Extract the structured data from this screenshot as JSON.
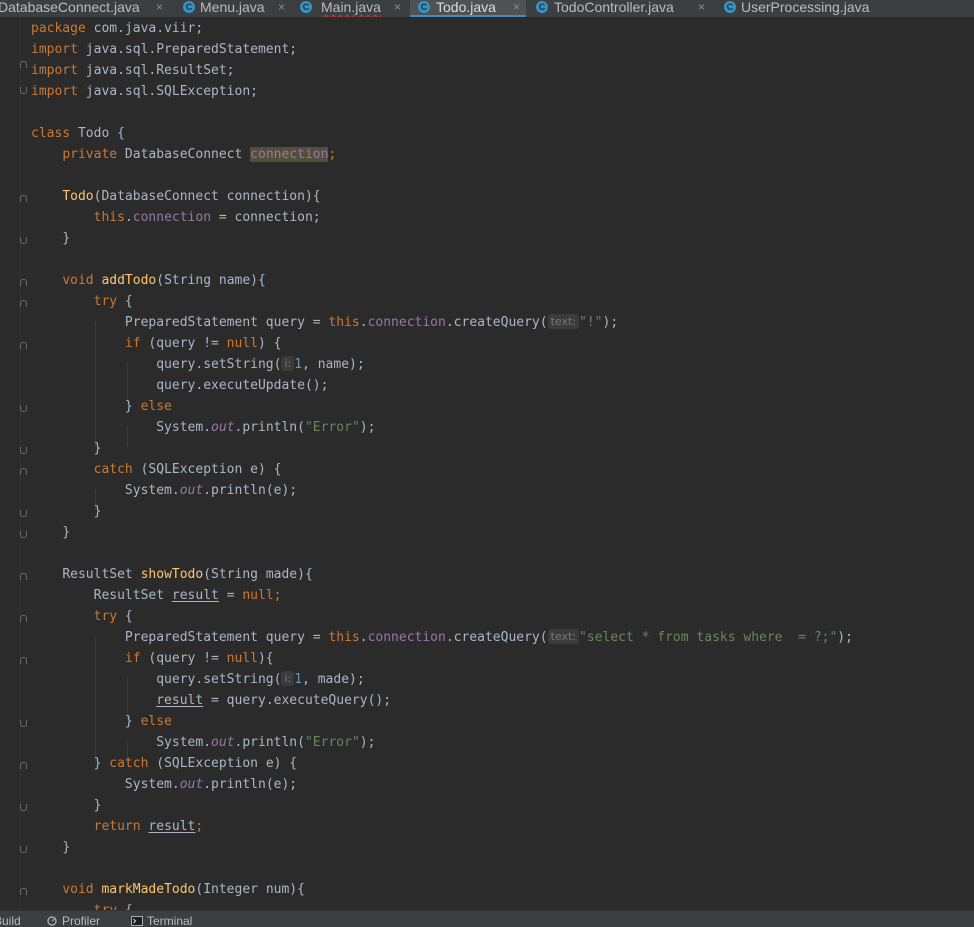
{
  "tabs": [
    {
      "label": "DatabaseConnect.java",
      "close": "×",
      "active": false,
      "icon": "C"
    },
    {
      "label": "Menu.java",
      "close": "×",
      "active": false,
      "icon": "C"
    },
    {
      "label": "Main.java",
      "close": "×",
      "active": false,
      "icon": "C"
    },
    {
      "label": "Todo.java",
      "close": "×",
      "active": true,
      "icon": "C"
    },
    {
      "label": "TodoController.java",
      "close": "×",
      "active": false,
      "icon": "C"
    },
    {
      "label": "UserProcessing.java",
      "close": "",
      "active": false,
      "icon": "C"
    }
  ],
  "code": {
    "package_kw": "package",
    "package_name": " com.java.viir;",
    "import_kw": "import",
    "imports": [
      " java.sql.PreparedStatement;",
      " java.sql.ResultSet;",
      " java.sql.SQLException;"
    ],
    "class_decl": "class",
    "class_name": " Todo {",
    "private_kw": "private",
    "field_type": " DatabaseConnect ",
    "field_name": "connection",
    "semicolon": ";",
    "ctor_name": "Todo",
    "ctor_params": "(DatabaseConnect connection){",
    "this_kw": "this",
    "dot_connection": ".",
    "connection": "connection",
    "assign_conn": " = connection;",
    "close_brace": "}",
    "void_kw": "void",
    "addTodo": "addTodo",
    "addTodo_params": "(String name){",
    "try_kw": "try",
    "open_brace": " {",
    "prepared": "PreparedStatement query = ",
    "createQuery": ".createQuery(",
    "hint_text": "text:",
    "str_bang": "\"!\"",
    "paren_semi": ");",
    "if_kw": "if",
    "if_query": " (query != ",
    "null_kw": "null",
    "if_close_space": ") {",
    "if_close": "){",
    "setString": "query.setString(",
    "hint_i": "i:",
    "num_one": "1",
    "set_name": ", name);",
    "set_made": ", made);",
    "executeUpdate": "query.executeUpdate();",
    "else_close": "} ",
    "else_kw": "else",
    "system": "System.",
    "out": "out",
    "println_open": ".println(",
    "str_error": "\"Error\"",
    "println_e": ".println(e);",
    "catch_kw": "catch",
    "catch_params": " (SQLException e) {",
    "resultset_type": "ResultSet ",
    "showTodo": "showTodo",
    "showTodo_params": "(String made){",
    "result_decl_type": "ResultSet ",
    "result": "result",
    "assign_null": " = ",
    "str_select": "\"select * from tasks where  = ?;\"",
    "assign_exec": " = query.executeQuery();",
    "return_kw": "return",
    "markMadeTodo": "markMadeTodo",
    "markMadeTodo_params": "(Integer num){"
  },
  "bottom_bar": [
    {
      "label": "Build",
      "icon": "build-icon"
    },
    {
      "label": "Profiler",
      "icon": "profiler-icon"
    },
    {
      "label": "Terminal",
      "icon": "terminal-icon"
    }
  ]
}
